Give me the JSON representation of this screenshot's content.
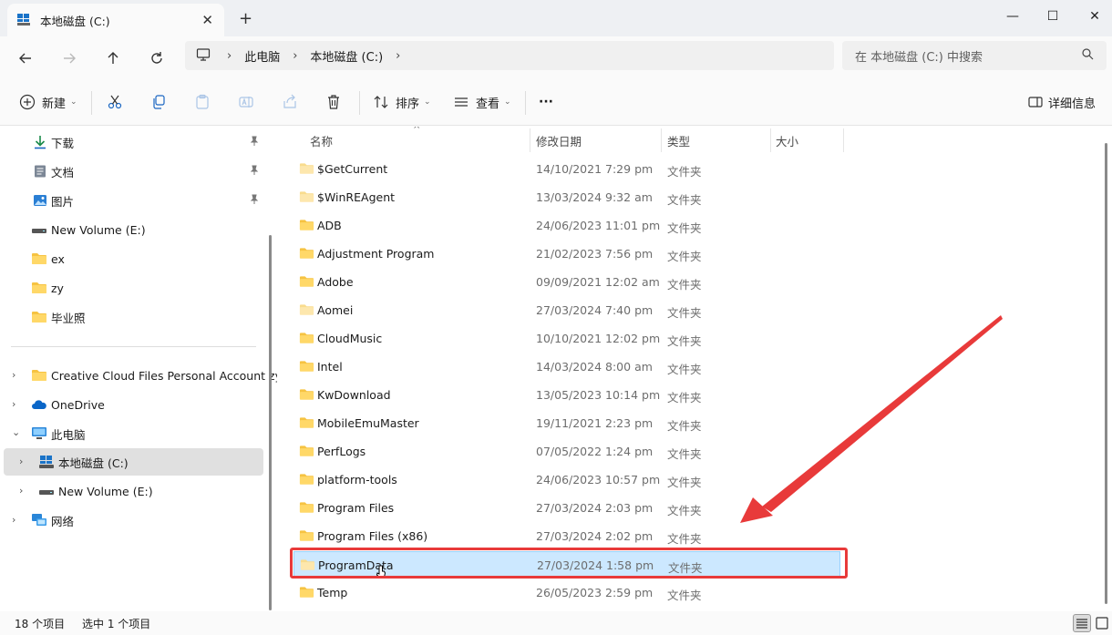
{
  "window": {
    "tab_title": "本地磁盘 (C:)",
    "tab_close": "✕",
    "new_tab": "+",
    "minimize": "—",
    "maximize": "☐",
    "close": "✕"
  },
  "address": {
    "breadcrumbs": [
      "此电脑",
      "本地磁盘 (C:)"
    ],
    "separator": "›",
    "search_placeholder": "在 本地磁盘 (C:) 中搜索"
  },
  "toolbar": {
    "new_label": "新建",
    "sort_label": "排序",
    "view_label": "查看",
    "more_label": "···",
    "details_label": "详细信息"
  },
  "sidebar": {
    "quick_access": [
      {
        "label": "下载",
        "icon": "download-icon",
        "pinned": true
      },
      {
        "label": "文档",
        "icon": "document-icon",
        "pinned": true
      },
      {
        "label": "图片",
        "icon": "picture-icon",
        "pinned": true
      },
      {
        "label": "New Volume (E:)",
        "icon": "drive-icon",
        "pinned": false
      },
      {
        "label": "ex",
        "icon": "folder-icon",
        "pinned": false
      },
      {
        "label": "zy",
        "icon": "folder-icon",
        "pinned": false
      },
      {
        "label": "毕业照",
        "icon": "folder-icon",
        "pinned": false
      }
    ],
    "tree": [
      {
        "label": "Creative Cloud Files Personal Account zy",
        "icon": "folder-icon",
        "expanded": false
      },
      {
        "label": "OneDrive",
        "icon": "cloud-icon",
        "expanded": false
      },
      {
        "label": "此电脑",
        "icon": "computer-icon",
        "expanded": true
      },
      {
        "label": "本地磁盘 (C:)",
        "icon": "windows-drive-icon",
        "expanded": false,
        "selected": true
      },
      {
        "label": "New Volume (E:)",
        "icon": "drive-icon",
        "expanded": false
      },
      {
        "label": "网络",
        "icon": "network-icon",
        "expanded": false
      }
    ]
  },
  "columns": {
    "name": "名称",
    "modified": "修改日期",
    "type": "类型",
    "size": "大小"
  },
  "files": [
    {
      "name": "$GetCurrent",
      "modified": "14/10/2021 7:29 pm",
      "type": "文件夹",
      "faded": true
    },
    {
      "name": "$WinREAgent",
      "modified": "13/03/2024 9:32 am",
      "type": "文件夹",
      "faded": true
    },
    {
      "name": "ADB",
      "modified": "24/06/2023 11:01 pm",
      "type": "文件夹",
      "faded": false
    },
    {
      "name": "Adjustment Program",
      "modified": "21/02/2023 7:56 pm",
      "type": "文件夹",
      "faded": false
    },
    {
      "name": "Adobe",
      "modified": "09/09/2021 12:02 am",
      "type": "文件夹",
      "faded": false
    },
    {
      "name": "Aomei",
      "modified": "27/03/2024 7:40 pm",
      "type": "文件夹",
      "faded": true
    },
    {
      "name": "CloudMusic",
      "modified": "10/10/2021 12:02 pm",
      "type": "文件夹",
      "faded": false
    },
    {
      "name": "Intel",
      "modified": "14/03/2024 8:00 am",
      "type": "文件夹",
      "faded": false
    },
    {
      "name": "KwDownload",
      "modified": "13/05/2023 10:14 pm",
      "type": "文件夹",
      "faded": false
    },
    {
      "name": "MobileEmuMaster",
      "modified": "19/11/2021 2:23 pm",
      "type": "文件夹",
      "faded": false
    },
    {
      "name": "PerfLogs",
      "modified": "07/05/2022 1:24 pm",
      "type": "文件夹",
      "faded": false
    },
    {
      "name": "platform-tools",
      "modified": "24/06/2023 10:57 pm",
      "type": "文件夹",
      "faded": false
    },
    {
      "name": "Program Files",
      "modified": "27/03/2024 2:03 pm",
      "type": "文件夹",
      "faded": false
    },
    {
      "name": "Program Files (x86)",
      "modified": "27/03/2024 2:02 pm",
      "type": "文件夹",
      "faded": false
    },
    {
      "name": "ProgramData",
      "modified": "27/03/2024 1:58 pm",
      "type": "文件夹",
      "faded": true,
      "selected": true
    },
    {
      "name": "Temp",
      "modified": "26/05/2023 2:59 pm",
      "type": "文件夹",
      "faded": false
    }
  ],
  "status": {
    "item_count": "18 个项目",
    "selection": "选中 1 个项目"
  },
  "colors": {
    "folder": "#f6c342",
    "folder_faded": "#f9dc8e",
    "selection_bg": "#cce8ff",
    "annotation_red": "#e83a3a",
    "accent_blue": "#0067c0"
  }
}
